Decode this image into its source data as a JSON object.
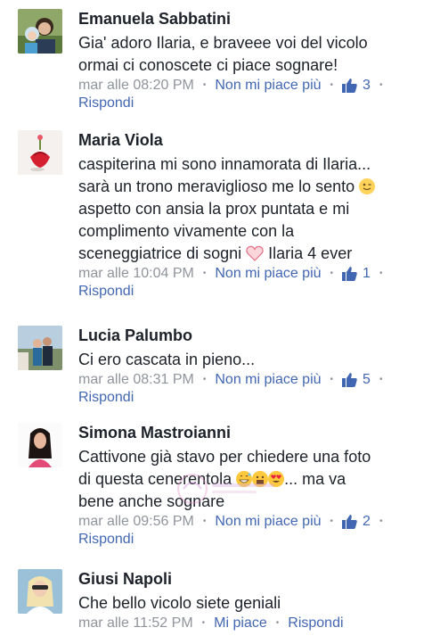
{
  "comments": [
    {
      "name": "Emanuela Sabbatini",
      "lines": [
        "Gia' adoro Ilaria, e braveee voi del vicolo",
        "ormai ci conoscete ci piace sognare!"
      ],
      "time": "mar alle 08:20 PM",
      "like_action": "Non mi piace più",
      "likes": "3",
      "reply": "Rispondi"
    },
    {
      "name": "Maria Viola",
      "lines": [
        "caspiterina mi sono innamorata di Ilaria...",
        "sarà un trono meraviglioso me lo sento",
        "aspetto con ansia la prox puntata e mi",
        "complimento vivamente con la",
        "sceneggiatrice di sogni",
        "Ilaria 4 ever"
      ],
      "time": "mar alle 10:04 PM",
      "like_action": "Non mi piace più",
      "likes": "1",
      "reply": "Rispondi"
    },
    {
      "name": "Lucia Palumbo",
      "lines": [
        "Ci ero cascata in pieno..."
      ],
      "time": "mar alle 08:31 PM",
      "like_action": "Non mi piace più",
      "likes": "5",
      "reply": "Rispondi"
    },
    {
      "name": "Simona Mastroianni",
      "lines": [
        "Cattivone già stavo per chiedere una foto",
        "di questa cenerentola",
        "... ma va",
        "bene anche sognare"
      ],
      "time": "mar alle 09:56 PM",
      "like_action": "Non mi piace più",
      "likes": "2",
      "reply": "Rispondi"
    },
    {
      "name": "Giusi Napoli",
      "lines": [
        "Che bello vicolo siete geniali"
      ],
      "time": "mar alle 11:52 PM",
      "like_action": "Mi piace",
      "reply": "Rispondi"
    }
  ],
  "colors": {
    "text": "#1d2129",
    "meta": "#90949c",
    "link": "#4267b2"
  }
}
